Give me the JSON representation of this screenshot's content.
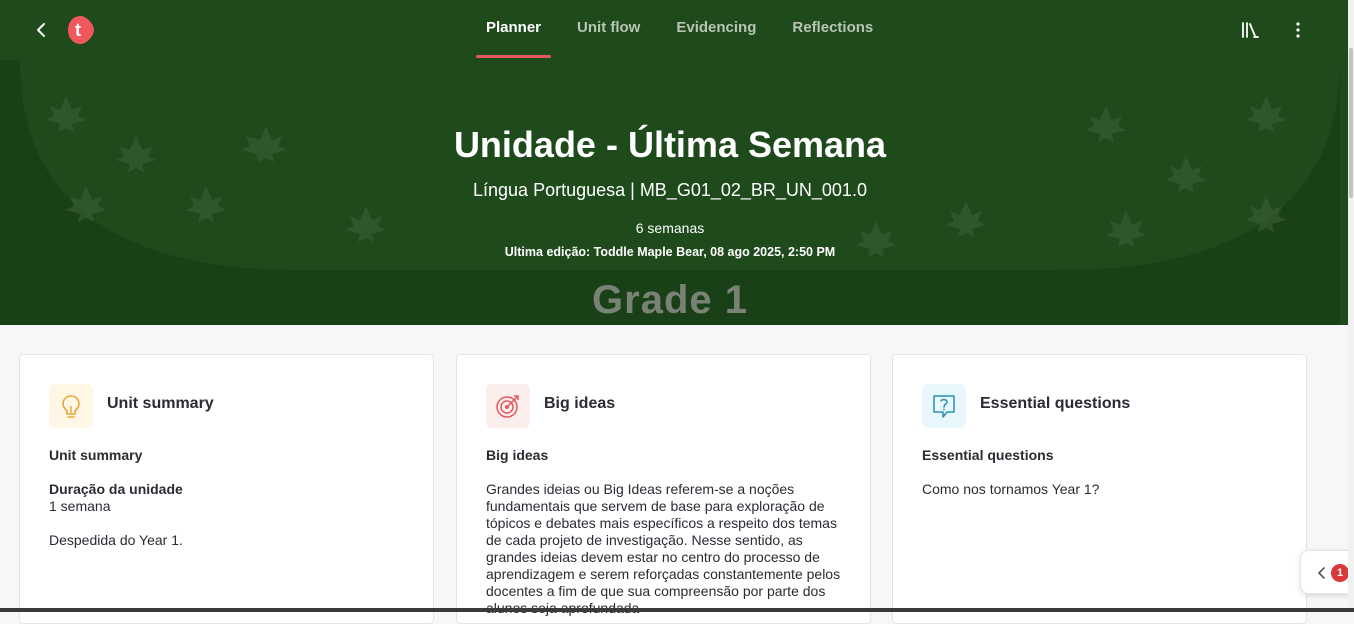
{
  "header": {
    "tabs": [
      {
        "label": "Planner",
        "active": true
      },
      {
        "label": "Unit flow",
        "active": false
      },
      {
        "label": "Evidencing",
        "active": false
      },
      {
        "label": "Reflections",
        "active": false
      }
    ],
    "logo_letter": "t",
    "accent_color": "#e4595c"
  },
  "hero": {
    "title": "Unidade - Última Semana",
    "subtitle": "Língua Portuguesa | MB_G01_02_BR_UN_001.0",
    "duration": "6 semanas",
    "last_edited": "Ultima edição: Toddle Maple Bear, 08 ago 2025, 2:50 PM",
    "banner_text": "Grade 1",
    "background_color": "#1f4a1c"
  },
  "cards": {
    "summary": {
      "title": "Unit summary",
      "subtitle": "Unit summary",
      "field_label": "Duração da unidade",
      "field_value": "1 semana",
      "text": "Despedida do Year 1.",
      "icon": "lightbulb-icon"
    },
    "big_ideas": {
      "title": "Big ideas",
      "subtitle": "Big ideas",
      "text": "Grandes ideias ou Big Ideas referem-se a noções fundamentais que servem de base para exploração de tópicos e debates mais específicos a respeito dos temas de cada projeto de investigação. Nesse sentido, as grandes ideias devem estar no centro do processo de aprendizagem e serem reforçadas constantemente pelos docentes a fim de que sua compreensão por parte dos alunos seja aprofundada",
      "icon": "target-icon"
    },
    "questions": {
      "title": "Essential questions",
      "subtitle": "Essential questions",
      "text": "Como nos tornamos Year 1?",
      "icon": "question-icon"
    }
  },
  "drawer": {
    "badge_count": "1"
  }
}
